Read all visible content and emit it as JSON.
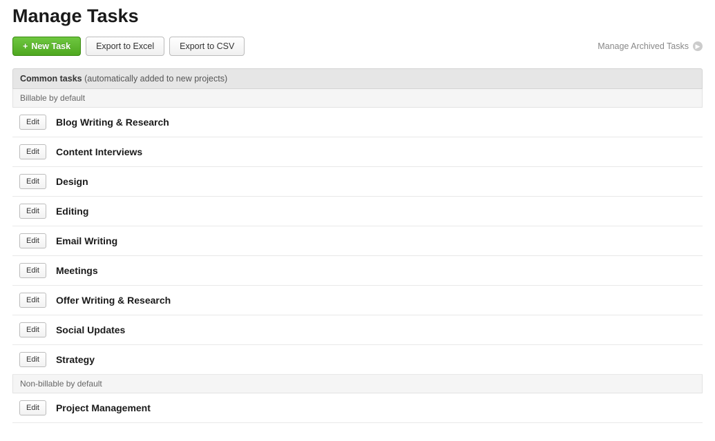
{
  "page": {
    "title": "Manage Tasks"
  },
  "toolbar": {
    "new_task_label": "New Task",
    "export_excel_label": "Export to Excel",
    "export_csv_label": "Export to CSV",
    "archived_link_label": "Manage Archived Tasks"
  },
  "section": {
    "title": "Common tasks",
    "subtitle": "(automatically added to new projects)"
  },
  "groups": {
    "billable_label": "Billable by default",
    "non_billable_label": "Non-billable by default"
  },
  "edit_label": "Edit",
  "tasks": {
    "billable": [
      {
        "name": "Blog Writing & Research"
      },
      {
        "name": "Content Interviews"
      },
      {
        "name": "Design"
      },
      {
        "name": "Editing"
      },
      {
        "name": "Email Writing"
      },
      {
        "name": "Meetings"
      },
      {
        "name": "Offer Writing & Research"
      },
      {
        "name": "Social Updates"
      },
      {
        "name": "Strategy"
      }
    ],
    "non_billable": [
      {
        "name": "Project Management"
      }
    ]
  }
}
